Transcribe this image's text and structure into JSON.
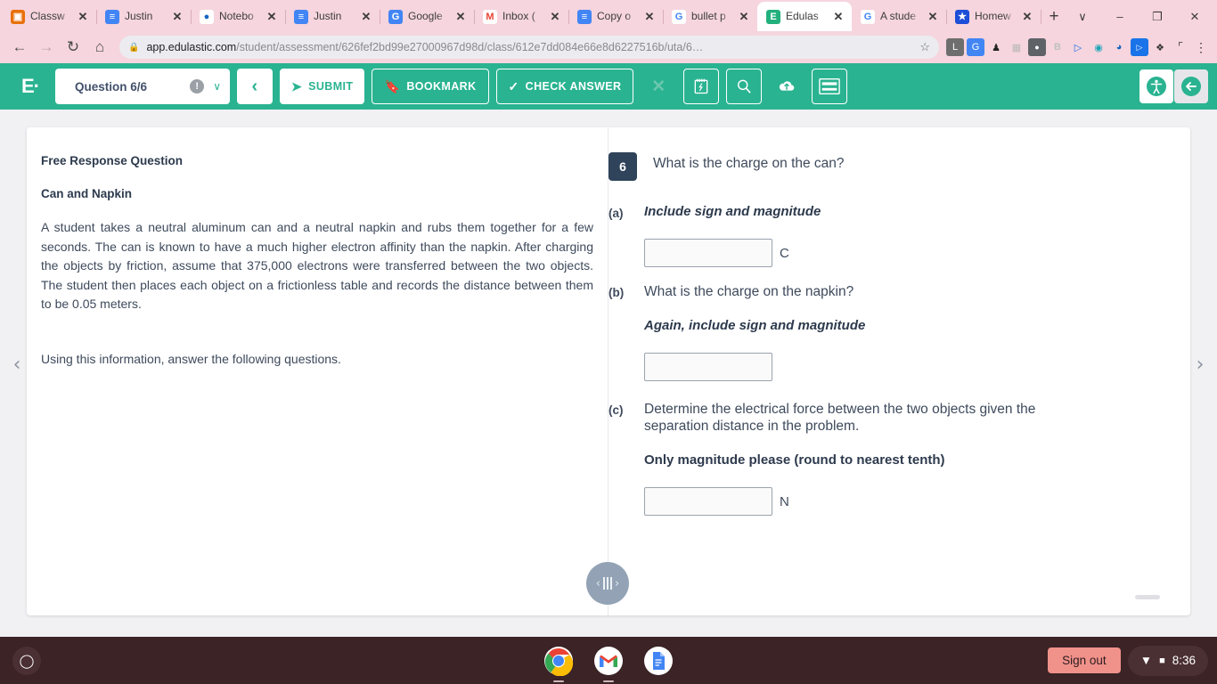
{
  "browser": {
    "tabs": [
      {
        "title": "Classw",
        "favicon": "classroom-icon",
        "active": false
      },
      {
        "title": "Justin ",
        "favicon": "google-docs-icon",
        "active": false
      },
      {
        "title": "Notebo",
        "favicon": "notebook-icon",
        "active": false
      },
      {
        "title": "Justin ",
        "favicon": "google-docs-icon",
        "active": false
      },
      {
        "title": "Google",
        "favicon": "google-translate-icon",
        "active": false
      },
      {
        "title": "Inbox (",
        "favicon": "gmail-icon",
        "active": false
      },
      {
        "title": "Copy o",
        "favicon": "google-docs-icon",
        "active": false
      },
      {
        "title": "bullet p",
        "favicon": "google-icon",
        "active": false
      },
      {
        "title": "Edulas",
        "favicon": "edulastic-icon",
        "active": true
      },
      {
        "title": "A stude",
        "favicon": "google-icon",
        "active": false
      },
      {
        "title": "Homew",
        "favicon": "shield-icon",
        "active": false
      }
    ],
    "tab_close_label": "✕",
    "new_tab_label": "+",
    "window_controls": {
      "tablist": "∨",
      "minimize": "–",
      "maximize": "❐",
      "close": "✕"
    },
    "nav": {
      "back": "←",
      "forward": "→",
      "reload": "↻",
      "home": "⌂"
    },
    "omnibox": {
      "lock_icon": "lock-icon",
      "url_domain": "app.edulastic.com",
      "url_path": "/student/assessment/626fef2bd99e27000967d98d/class/612e7dd084e66e8d6227516b/uta/6…",
      "star_icon": "☆"
    },
    "extensions": [
      {
        "name": "lastpass-extension-icon",
        "glyph": "L"
      },
      {
        "name": "google-translate-extension-icon",
        "glyph": "G"
      },
      {
        "name": "penguin-extension-icon",
        "glyph": "♟"
      },
      {
        "name": "grayed-extension-icon",
        "glyph": "▧"
      },
      {
        "name": "lightbulb-extension-icon",
        "glyph": "●"
      },
      {
        "name": "bitmoji-extension-icon",
        "glyph": "B"
      },
      {
        "name": "blue-play-extension-icon",
        "glyph": "▷"
      },
      {
        "name": "teal-circle-extension-icon",
        "glyph": "◉"
      },
      {
        "name": "notebook-extension-icon",
        "glyph": "◕"
      },
      {
        "name": "blue-play2-extension-icon",
        "glyph": "▷"
      },
      {
        "name": "puzzle-extensions-icon",
        "glyph": "❖"
      },
      {
        "name": "cast-icon",
        "glyph": "⬚"
      },
      {
        "name": "chrome-menu-icon",
        "glyph": "⋮"
      }
    ]
  },
  "appbar": {
    "brand": "E·",
    "question_selector": {
      "label": "Question 6/6",
      "warn_icon": "!",
      "chevron": "∨"
    },
    "prev_label": "‹",
    "submit_label": "SUBMIT",
    "bookmark_label": "BOOKMARK",
    "check_answer_label": "CHECK ANSWER",
    "tools": [
      {
        "name": "close-tool-icon",
        "glyph": "✕",
        "state": "disabled"
      },
      {
        "name": "scratchpad-icon",
        "glyph": "὜9",
        "state": "outline"
      },
      {
        "name": "magnify-icon",
        "glyph": "⌕",
        "state": "outline"
      },
      {
        "name": "cloud-upload-icon",
        "glyph": "☁",
        "state": "filled"
      },
      {
        "name": "menu-lines-icon",
        "glyph": "☰",
        "state": "outline"
      }
    ],
    "accessibility_icon": "accessibility-icon",
    "exit_icon": "exit-arrow-icon"
  },
  "left_panel": {
    "heading": "Free Response Question",
    "subheading": "Can and Napkin",
    "body": "A student takes a neutral aluminum can and a neutral napkin and rubs them together for a few seconds. The can is known to have a much higher electron affinity than the napkin. After charging the objects by friction, assume that 375,000 electrons were transferred between the two objects. The student then places each object on a frictionless table and records the distance between them to be 0.05 meters.",
    "footer": "Using this information, answer the following questions."
  },
  "right_panel": {
    "question_number": "6",
    "question_text": "What is the charge on the can?",
    "parts": [
      {
        "label": "(a)",
        "prompt": "",
        "emphasis": "Include sign and magnitude",
        "emphasis_style": "italic",
        "answer_value": "",
        "unit": "C"
      },
      {
        "label": "(b)",
        "prompt": "What is the charge on the napkin?",
        "emphasis": "Again, include sign and magnitude",
        "emphasis_style": "italic",
        "answer_value": "",
        "unit": ""
      },
      {
        "label": "(c)",
        "prompt": "Determine the electrical force between the two objects given the separation distance in the problem.",
        "emphasis": "Only magnitude please (round to nearest tenth)",
        "emphasis_style": "bold",
        "answer_value": "",
        "unit": "N"
      }
    ]
  },
  "navigation": {
    "prev_arrow": "‹",
    "next_arrow": "›"
  },
  "splitter": {
    "left_arrow": "‹",
    "right_arrow": "›"
  },
  "shelf": {
    "launcher_icon": "launcher-circle-icon",
    "apps": [
      {
        "name": "chrome-app-icon"
      },
      {
        "name": "gmail-app-icon"
      },
      {
        "name": "google-docs-app-icon"
      }
    ],
    "sign_out_label": "Sign out",
    "wifi_icon": "wifi-icon",
    "battery_icon": "battery-icon",
    "time": "8:36"
  },
  "colors": {
    "accent_green": "#2ab391",
    "question_badge": "#2f435a",
    "shelf": "#3b2326",
    "tabstrip": "#f6d5de",
    "signout": "#f0918a"
  }
}
